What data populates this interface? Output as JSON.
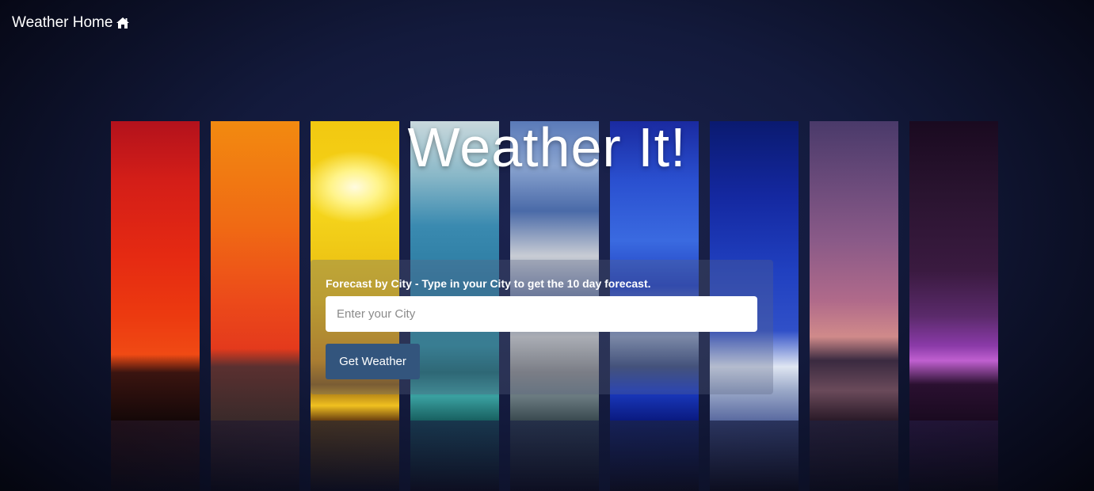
{
  "nav": {
    "brand_label": "Weather Home",
    "icon": "home-icon"
  },
  "hero": {
    "title": "Weather It!"
  },
  "search": {
    "label": "Forecast by City - Type in your City to get the 10 day forecast.",
    "input_value": "",
    "placeholder": "Enter your City",
    "button_label": "Get Weather"
  },
  "colors": {
    "button": "#33557d",
    "background": "#131a3c"
  },
  "background_strips": [
    {
      "name": "red-sunset-strip"
    },
    {
      "name": "orange-sunset-strip"
    },
    {
      "name": "yellow-sun-strip"
    },
    {
      "name": "teal-clouds-strip"
    },
    {
      "name": "cloudy-sky-strip"
    },
    {
      "name": "blue-storm-strip"
    },
    {
      "name": "night-blue-strip"
    },
    {
      "name": "purple-dusk-strip"
    },
    {
      "name": "dark-purple-night-strip"
    }
  ]
}
